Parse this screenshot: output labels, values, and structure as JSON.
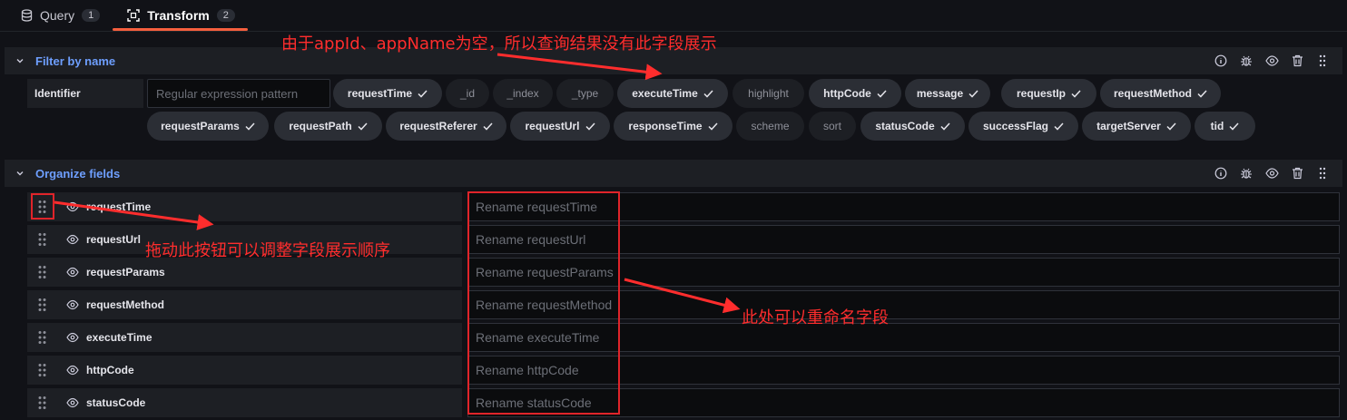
{
  "tabs": [
    {
      "label": "Query",
      "count": "1",
      "icon": "database-icon",
      "active": false
    },
    {
      "label": "Transform",
      "count": "2",
      "icon": "transform-icon",
      "active": true
    }
  ],
  "filter_section": {
    "title": "Filter by name",
    "identifier_label": "Identifier",
    "regex_placeholder": "Regular expression pattern",
    "chips_row1": [
      {
        "label": "requestTime",
        "selected": true
      },
      {
        "label": "_id",
        "selected": false
      },
      {
        "label": "_index",
        "selected": false
      },
      {
        "label": "_type",
        "selected": false
      },
      {
        "label": "executeTime",
        "selected": true
      },
      {
        "label": "highlight",
        "selected": false
      },
      {
        "label": "httpCode",
        "selected": true
      },
      {
        "label": "message",
        "selected": true
      },
      {
        "label": "requestIp",
        "selected": true
      },
      {
        "label": "requestMethod",
        "selected": true
      }
    ],
    "chips_row2": [
      {
        "label": "requestParams",
        "selected": true
      },
      {
        "label": "requestPath",
        "selected": true
      },
      {
        "label": "requestReferer",
        "selected": true
      },
      {
        "label": "requestUrl",
        "selected": true
      },
      {
        "label": "responseTime",
        "selected": true
      },
      {
        "label": "scheme",
        "selected": false
      },
      {
        "label": "sort",
        "selected": false
      },
      {
        "label": "statusCode",
        "selected": true
      },
      {
        "label": "successFlag",
        "selected": true
      },
      {
        "label": "targetServer",
        "selected": true
      },
      {
        "label": "tid",
        "selected": true
      }
    ]
  },
  "organize_section": {
    "title": "Organize fields",
    "fields": [
      {
        "name": "requestTime",
        "rename_placeholder": "Rename requestTime"
      },
      {
        "name": "requestUrl",
        "rename_placeholder": "Rename requestUrl"
      },
      {
        "name": "requestParams",
        "rename_placeholder": "Rename requestParams"
      },
      {
        "name": "requestMethod",
        "rename_placeholder": "Rename requestMethod"
      },
      {
        "name": "executeTime",
        "rename_placeholder": "Rename executeTime"
      },
      {
        "name": "httpCode",
        "rename_placeholder": "Rename httpCode"
      },
      {
        "name": "statusCode",
        "rename_placeholder": "Rename statusCode"
      }
    ]
  },
  "annotations": {
    "top": "由于appId、appName为空，所以查询结果没有此字段展示",
    "drag": "拖动此按钮可以调整字段展示顺序",
    "rename": "此处可以重命名字段"
  },
  "colors": {
    "background": "#111217",
    "section_header": "#1d1f24",
    "accent_link": "#6e9fff",
    "active_tab_underline": "#f55f3e",
    "annotation_red": "#ff2d2d"
  }
}
